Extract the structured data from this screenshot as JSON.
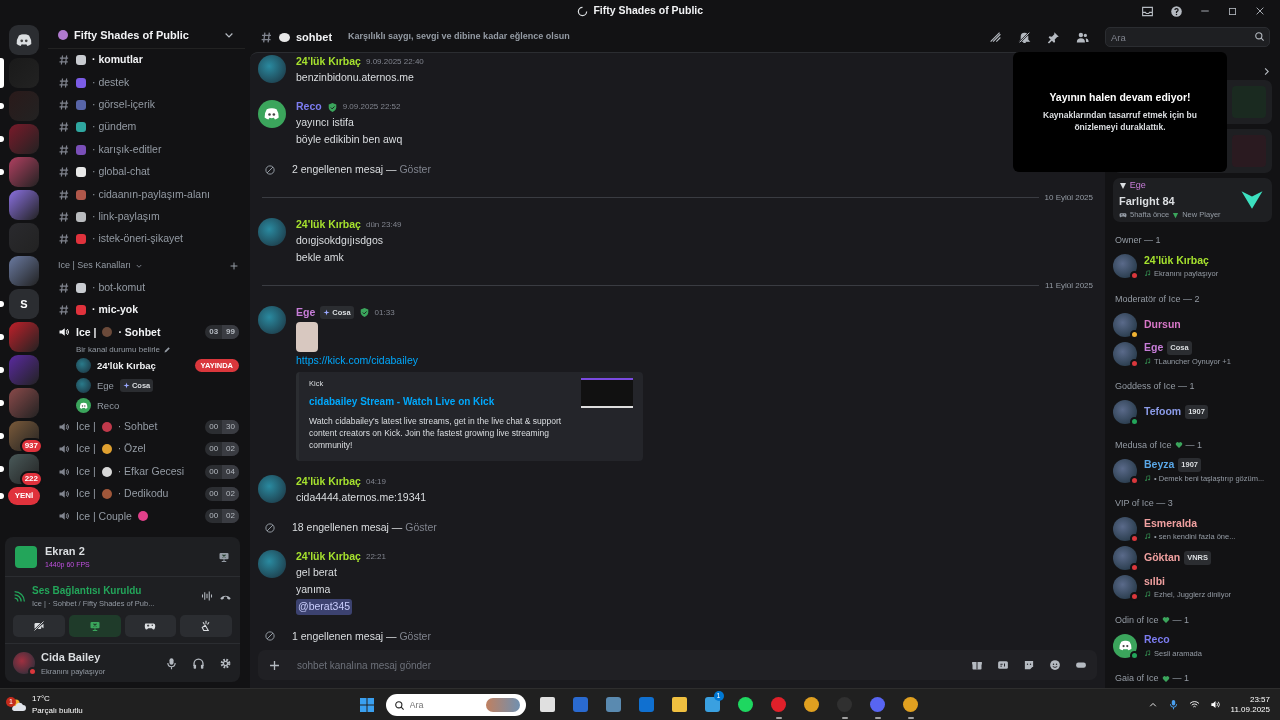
{
  "window": {
    "title": "Fifty Shades of Public"
  },
  "servers": [
    {
      "kind": "home",
      "selected": false,
      "unread": false
    },
    {
      "kind": "server",
      "selected": true,
      "unread": false
    },
    {
      "kind": "server",
      "selected": false,
      "unread": true
    },
    {
      "kind": "server",
      "selected": false,
      "unread": true
    },
    {
      "kind": "server",
      "selected": false,
      "unread": true
    },
    {
      "kind": "server",
      "selected": false,
      "unread": false
    },
    {
      "kind": "server",
      "selected": false,
      "unread": false
    },
    {
      "kind": "server",
      "selected": false,
      "unread": false
    },
    {
      "kind": "server",
      "selected": false,
      "unread": true,
      "label": "S"
    },
    {
      "kind": "server",
      "selected": false,
      "unread": true
    },
    {
      "kind": "server",
      "selected": false,
      "unread": true
    },
    {
      "kind": "server",
      "selected": false,
      "unread": true
    },
    {
      "kind": "server",
      "selected": false,
      "unread": true,
      "badge": "937"
    },
    {
      "kind": "server",
      "selected": false,
      "unread": true,
      "badge": "222"
    },
    {
      "kind": "new",
      "selected": false,
      "unread": true,
      "label": "YENİ"
    }
  ],
  "server_name": "Fifty Shades of Public",
  "sidebar": {
    "items": [
      {
        "kind": "text",
        "name": "· komutlar",
        "unread": true,
        "color": "#c9ccd1"
      },
      {
        "kind": "text",
        "name": "· destek",
        "unread": false,
        "color": "#7b5ce6"
      },
      {
        "kind": "text",
        "name": "· görsel-içerik",
        "unread": false,
        "color": "#5865a8"
      },
      {
        "kind": "text",
        "name": "· gündem",
        "unread": false,
        "color": "#2fa7a0"
      },
      {
        "kind": "text",
        "name": "· karışık-editler",
        "unread": false,
        "color": "#7a4fb8"
      },
      {
        "kind": "text",
        "name": "· global-chat",
        "unread": false,
        "color": "#e8e8e8"
      },
      {
        "kind": "text",
        "name": "· cidaanın-paylaşım-alanı",
        "unread": false,
        "color": "#b0574a"
      },
      {
        "kind": "text",
        "name": "· link-paylaşım",
        "unread": false,
        "color": "#b9bbbe"
      },
      {
        "kind": "text",
        "name": "· istek-öneri-şikayet",
        "unread": false,
        "color": "#e0323c"
      },
      {
        "kind": "category",
        "name": "Ice | Ses Kanalları"
      },
      {
        "kind": "text",
        "name": "· bot-komut",
        "unread": false,
        "color": "#c9ccd1"
      },
      {
        "kind": "text",
        "name": "· mic-yok",
        "unread": true,
        "color": "#e0323c"
      },
      {
        "kind": "voice",
        "prefix": "Ice |",
        "name": "· Sohbet",
        "active": true,
        "count": "03",
        "limit": "99",
        "color": "#6b4a3a",
        "status": "Bir kanal durumu belirle",
        "members": [
          {
            "name": "24'lük Kırbaç",
            "live": "YAYINDA",
            "default_avatar": false
          },
          {
            "name": "Ege",
            "tag": "Cosa",
            "default_avatar": false
          },
          {
            "name": "Reco",
            "default_avatar": true
          }
        ]
      },
      {
        "kind": "voice",
        "prefix": "Ice |",
        "name": "· Sohbet",
        "active": false,
        "count": "00",
        "limit": "30",
        "color": "#c0394b"
      },
      {
        "kind": "voice",
        "prefix": "Ice |",
        "name": "· Özel",
        "active": false,
        "count": "00",
        "limit": "02",
        "color": "#e0a030"
      },
      {
        "kind": "voice",
        "prefix": "Ice |",
        "name": "· Efkar Gecesi",
        "active": false,
        "count": "00",
        "limit": "04",
        "color": "#d8d8d8"
      },
      {
        "kind": "voice",
        "prefix": "Ice |",
        "name": "· Dedikodu",
        "active": false,
        "count": "00",
        "limit": "02",
        "color": "#a0573a"
      },
      {
        "kind": "voice",
        "prefix": "Ice | Couple",
        "active": false,
        "count": "00",
        "limit": "02",
        "color": "#e0408a"
      }
    ]
  },
  "voice_panel": {
    "stream_title": "Ekran 2",
    "stream_quality": "1440p 60 FPS",
    "connection": "Ses Bağlantısı Kuruldu",
    "connection_detail": "Ice | · Sohbet / Fifty Shades of Pub...",
    "buttons": [
      {
        "kind": "camera",
        "on": false
      },
      {
        "kind": "screen",
        "on": true
      },
      {
        "kind": "activity",
        "on": false
      },
      {
        "kind": "soundboard",
        "on": false
      }
    ]
  },
  "user": {
    "name": "Cida Bailey",
    "status": "Ekranını paylaşıyor"
  },
  "channel": {
    "name": "sohbet",
    "topic": "Karşılıklı saygı, sevgi ve dibine kadar eğlence olsun"
  },
  "search": {
    "placeholder": "Ara"
  },
  "messages": [
    {
      "kind": "message",
      "author": "24'lük Kırbaç",
      "color": "#a6e22e",
      "time": "9.09.2025 22:40",
      "default_avatar": false,
      "lines": [
        "benzinbidonu.aternos.me"
      ]
    },
    {
      "kind": "message",
      "author": "Reco",
      "color": "#7c7cf0",
      "verified": true,
      "time": "9.09.2025 22:52",
      "default_avatar": true,
      "lines": [
        "yayıncı istifa",
        "böyle edikibin ben awq"
      ]
    },
    {
      "kind": "blocked",
      "text": "2 engellenen mesaj —",
      "action": "Göster"
    },
    {
      "kind": "divider",
      "text": "10 Eylül 2025"
    },
    {
      "kind": "message",
      "author": "24'lük Kırbaç",
      "color": "#a6e22e",
      "time": "dün 23:49",
      "default_avatar": false,
      "lines": [
        "doıgjsokdgıjısdgos",
        "bekle amk"
      ]
    },
    {
      "kind": "divider",
      "text": "11 Eylül 2025"
    },
    {
      "kind": "message",
      "author": "Ege",
      "color": "#c77dd8",
      "tag": "Cosa",
      "verified": true,
      "time": "01:33",
      "default_avatar": false,
      "image": true,
      "link": "https://kick.com/cidabailey",
      "embed": {
        "provider": "Kick",
        "title": "cidabailey Stream - Watch Live on Kick",
        "description": "Watch cidabailey's latest live streams, get in the live chat & support content creators on Kick. Join the fastest growing live streaming community!"
      }
    },
    {
      "kind": "message",
      "author": "24'lük Kırbaç",
      "color": "#a6e22e",
      "time": "04:19",
      "default_avatar": false,
      "lines": [
        "cida4444.aternos.me:19341"
      ]
    },
    {
      "kind": "blocked",
      "text": "18 engellenen mesaj —",
      "action": "Göster"
    },
    {
      "kind": "message",
      "author": "24'lük Kırbaç",
      "color": "#a6e22e",
      "time": "22:21",
      "default_avatar": false,
      "lines": [
        "gel berat",
        "yanıma"
      ],
      "mention": "@berat345"
    },
    {
      "kind": "blocked",
      "text": "1 engellenen mesaj —",
      "action": "Göster"
    }
  ],
  "composer": {
    "placeholder": "sohbet kanalına mesaj gönder"
  },
  "stream_notice": {
    "title": "Yayının halen devam ediyor!",
    "text": "Kaynaklarından tasarruf etmek için bu önizlemeyi duraklattık."
  },
  "activity": {
    "user": "Ege",
    "game": "Farlight 84",
    "since": "5hafta önce",
    "rank": "New Player"
  },
  "member_groups": [
    {
      "title": "Owner — 1",
      "members": [
        {
          "name": "24'lük Kırbaç",
          "color": "#a6e22e",
          "default_avatar": false,
          "presence": {
            "color": "#da373c"
          },
          "status": "Ekranını paylaşıyor"
        }
      ]
    },
    {
      "title": "Moderatör of Ice — 2",
      "members": [
        {
          "name": "Dursun",
          "color": "#d877c8",
          "default_avatar": false,
          "presence": {
            "color": "#f0b232"
          }
        },
        {
          "name": "Ege",
          "color": "#c77dd8",
          "default_avatar": false,
          "presence": {
            "color": "#da373c"
          },
          "tag": "Cosa",
          "status": "TLauncher Oynuyor +1"
        }
      ]
    },
    {
      "title": "Goddess of Ice — 1",
      "members": [
        {
          "name": "Tefoom",
          "color": "#8b9be8",
          "default_avatar": false,
          "presence": {
            "color": "#23a55a"
          },
          "tag": "1907"
        }
      ]
    },
    {
      "title": "Medusa of Ice",
      "count": "— 1",
      "members": [
        {
          "name": "Beyza",
          "color": "#5aa8e8",
          "default_avatar": false,
          "presence": {
            "color": "#da373c"
          },
          "tag": "1907",
          "status": "• Demek beni taşlaştırıp gözüm..."
        }
      ]
    },
    {
      "title": "VIP of Ice — 3",
      "members": [
        {
          "name": "Esmeralda",
          "color": "#f0a0a0",
          "default_avatar": false,
          "presence": {
            "color": "#da373c"
          },
          "status": "• sen kendini fazla öne..."
        },
        {
          "name": "Göktan",
          "color": "#f0a0a0",
          "default_avatar": false,
          "presence": {
            "color": "#da373c"
          },
          "tag": "VNRS"
        },
        {
          "name": "sılbi",
          "color": "#f0a0a0",
          "default_avatar": false,
          "presence": {
            "color": "#da373c"
          },
          "status": "Ezhel, Jugglerz dinliyor"
        }
      ]
    },
    {
      "title": "Odin of Ice",
      "count": "— 1",
      "members": [
        {
          "name": "Reco",
          "color": "#7c7cf0",
          "default_avatar": true,
          "presence": {
            "color": "#23a55a"
          },
          "status": "Sesli aramada"
        }
      ]
    },
    {
      "title": "Gaia of Ice",
      "count": "— 1"
    }
  ],
  "taskbar": {
    "temperature": "17°C",
    "weather": "Parçalı bulutlu",
    "weather_badge": "1",
    "search_placeholder": "Ara",
    "apps": [
      {
        "kind": "taskview",
        "running": false
      },
      {
        "kind": "store",
        "running": false
      },
      {
        "kind": "calculator",
        "running": false
      },
      {
        "kind": "outlook",
        "running": false
      },
      {
        "kind": "folder",
        "running": false
      },
      {
        "kind": "mail",
        "running": false,
        "badge": "1"
      },
      {
        "kind": "spotify",
        "running": false
      },
      {
        "kind": "opera",
        "running": true
      },
      {
        "kind": "chrome",
        "running": false
      },
      {
        "kind": "app",
        "running": true
      },
      {
        "kind": "discord",
        "running": true
      },
      {
        "kind": "chrome",
        "running": true
      }
    ],
    "time": "23:57",
    "date": "11.09.2025"
  }
}
